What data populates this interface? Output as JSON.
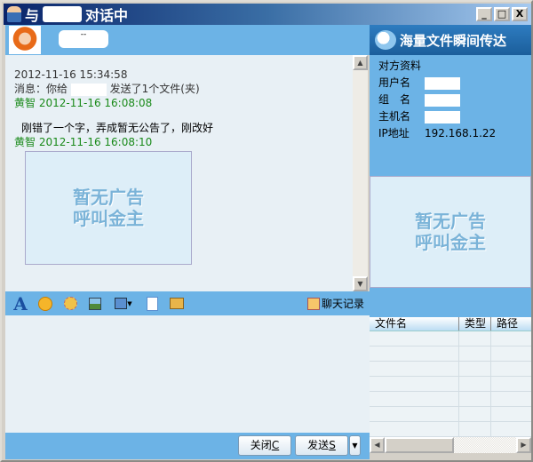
{
  "window": {
    "title_prefix": "与",
    "title_suffix": "对话中",
    "minimize": "_",
    "maximize": "□",
    "close": "X"
  },
  "header": {
    "contact_name_masked": "--"
  },
  "banner": {
    "text": "海量文件瞬间传达"
  },
  "chat": {
    "messages": [
      {
        "time": "2012-11-16 15:34:58",
        "text_prefix": "消息：你给",
        "text_suffix": "发送了1个文件(夹)"
      },
      {
        "sender": "黄智",
        "time": "2012-11-16 16:08:08",
        "text": "刚错了一个字，弄成暂无公告了，刚改好"
      },
      {
        "sender": "黄智",
        "time": "2012-11-16 16:08:10",
        "image_text": [
          "暂无广告",
          "呼叫金主"
        ]
      }
    ]
  },
  "toolbar": {
    "history_label": "聊天记录"
  },
  "buttons": {
    "close": "关闭",
    "close_key": "C",
    "send": "发送",
    "send_key": "S"
  },
  "profile": {
    "heading": "对方资料",
    "fields": [
      {
        "label": "用户名",
        "value": ""
      },
      {
        "label": "组　名",
        "value": ""
      },
      {
        "label": "主机名",
        "value": ""
      },
      {
        "label": "IP地址",
        "value": "192.168.1.22"
      }
    ]
  },
  "ad": {
    "text": [
      "暂无广告",
      "呼叫金主"
    ]
  },
  "file_table": {
    "columns": [
      "文件名",
      "类型",
      "路径"
    ]
  }
}
